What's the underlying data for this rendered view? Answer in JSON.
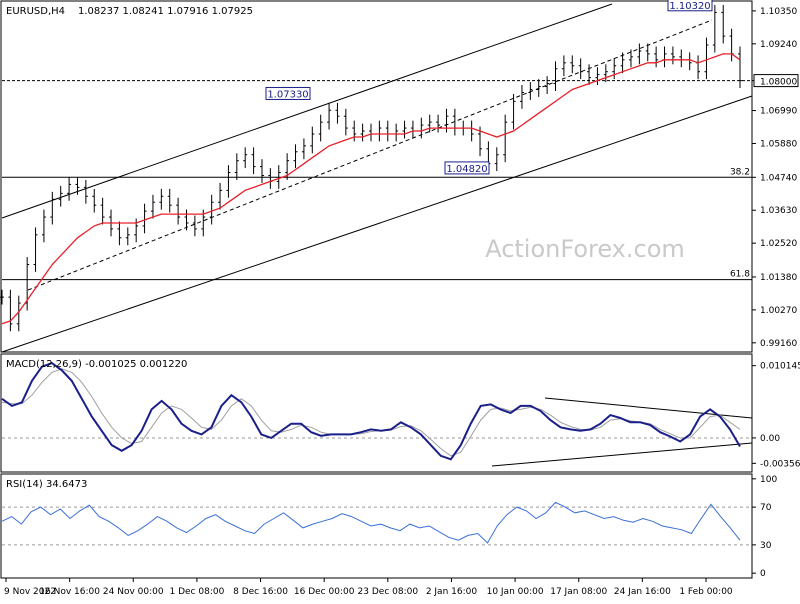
{
  "chart_data": [
    {
      "type": "line",
      "subtype": "ohlc",
      "symbol": "EURUSD,H4",
      "ohlc_header": "1.08237 1.08241 1.07916 1.07925",
      "watermark": "ActionForex.com",
      "x_ticks": [
        "9 Nov 2022",
        "16 Nov 16:00",
        "24 Nov 00:00",
        "1 Dec 08:00",
        "8 Dec 16:00",
        "16 Dec 00:00",
        "23 Dec 08:00",
        "2 Jan 16:00",
        "10 Jan 00:00",
        "17 Jan 08:00",
        "24 Jan 16:00",
        "1 Feb 00:00"
      ],
      "y_ticks": [
        "1.10350",
        "1.09240",
        "1.08000",
        "1.06990",
        "1.05880",
        "1.04740",
        "1.03630",
        "1.02520",
        "1.01380",
        "1.00270",
        "0.99160"
      ],
      "y_tick_values": [
        1.1035,
        1.0924,
        1.08,
        1.0699,
        1.0588,
        1.0474,
        1.0363,
        1.0252,
        1.0138,
        1.0027,
        0.9916
      ],
      "ylim": [
        0.9885,
        1.1065
      ],
      "price_label": "1.08000",
      "level_labels": [
        {
          "text": "1.07330",
          "value": 1.0733
        },
        {
          "text": "1.04820",
          "value": 1.0482
        },
        {
          "text": "1.10320",
          "value": 1.1032
        }
      ],
      "fib_levels": [
        {
          "label": "38.2",
          "value": 1.0474
        },
        {
          "label": "61.8",
          "value": 1.0129
        }
      ],
      "series": [
        {
          "color": "#000000",
          "values": [
            1.007,
            0.998,
            1.005,
            1.018,
            1.028,
            1.034,
            1.04,
            1.042,
            1.045,
            1.044,
            1.041,
            1.038,
            1.034,
            1.03,
            1.027,
            1.028,
            1.031,
            1.036,
            1.039,
            1.041,
            1.038,
            1.034,
            1.032,
            1.03,
            1.034,
            1.039,
            1.043,
            1.049,
            1.053,
            1.055,
            1.051,
            1.048,
            1.046,
            1.049,
            1.053,
            1.056,
            1.058,
            1.062,
            1.066,
            1.07,
            1.068,
            1.064,
            1.062,
            1.063,
            1.062,
            1.064,
            1.062,
            1.063,
            1.064,
            1.063,
            1.065,
            1.066,
            1.065,
            1.068,
            1.064,
            1.064,
            1.062,
            1.057,
            1.052,
            1.055,
            1.066,
            1.073,
            1.076,
            1.077,
            1.078,
            1.079,
            1.084,
            1.086,
            1.085,
            1.083,
            1.081,
            1.082,
            1.083,
            1.085,
            1.087,
            1.088,
            1.09,
            1.089,
            1.087,
            1.089,
            1.088,
            1.087,
            1.086,
            1.083,
            1.092,
            1.103,
            1.095,
            1.089,
            1.08
          ]
        },
        {
          "color": "#e8202a",
          "values": [
            0.998,
            0.999,
            1.002,
            1.006,
            1.01,
            1.014,
            1.018,
            1.021,
            1.024,
            1.027,
            1.029,
            1.031,
            1.032,
            1.032,
            1.032,
            1.032,
            1.032,
            1.033,
            1.034,
            1.035,
            1.035,
            1.035,
            1.035,
            1.035,
            1.035,
            1.036,
            1.037,
            1.039,
            1.041,
            1.043,
            1.044,
            1.045,
            1.046,
            1.047,
            1.048,
            1.05,
            1.052,
            1.054,
            1.056,
            1.058,
            1.059,
            1.06,
            1.061,
            1.061,
            1.062,
            1.062,
            1.062,
            1.062,
            1.062,
            1.063,
            1.063,
            1.064,
            1.064,
            1.064,
            1.064,
            1.064,
            1.064,
            1.063,
            1.062,
            1.061,
            1.062,
            1.063,
            1.065,
            1.067,
            1.069,
            1.071,
            1.073,
            1.075,
            1.077,
            1.078,
            1.079,
            1.08,
            1.081,
            1.082,
            1.083,
            1.084,
            1.085,
            1.086,
            1.086,
            1.087,
            1.087,
            1.087,
            1.087,
            1.086,
            1.087,
            1.088,
            1.089,
            1.089,
            1.087
          ]
        }
      ]
    },
    {
      "type": "line",
      "title": "MACD(12,26,9) -0.001025 0.001220",
      "y_ticks": [
        "0.010145",
        "0.00",
        "-0.003563"
      ],
      "y_tick_values": [
        0.010145,
        0.0,
        -0.003563
      ],
      "ylim": [
        -0.0045,
        0.0115
      ],
      "series": [
        {
          "color": "#1b1f8a",
          "values": [
            0.0055,
            0.0045,
            0.005,
            0.008,
            0.01,
            0.0105,
            0.0095,
            0.008,
            0.0055,
            0.003,
            0.001,
            -0.001,
            -0.0018,
            -0.001,
            0.001,
            0.004,
            0.0052,
            0.004,
            0.002,
            0.001,
            0.0005,
            0.0015,
            0.0045,
            0.006,
            0.005,
            0.003,
            0.0005,
            0.0,
            0.001,
            0.002,
            0.002,
            0.0008,
            0.0003,
            0.0005,
            0.0005,
            0.0005,
            0.0008,
            0.0012,
            0.001,
            0.0012,
            0.0022,
            0.0015,
            0.0005,
            -0.001,
            -0.0025,
            -0.003,
            -0.001,
            0.002,
            0.0045,
            0.0047,
            0.004,
            0.0035,
            0.0045,
            0.0045,
            0.0038,
            0.0025,
            0.0015,
            0.0012,
            0.001,
            0.0012,
            0.002,
            0.0032,
            0.0028,
            0.0022,
            0.0022,
            0.0018,
            0.0008,
            0.0002,
            -0.0005,
            0.0005,
            0.003,
            0.004,
            0.003,
            0.0012,
            -0.0012
          ]
        },
        {
          "color": "#a0a0a0",
          "values": [
            0.005,
            0.0048,
            0.0048,
            0.006,
            0.0078,
            0.0092,
            0.0097,
            0.0092,
            0.0078,
            0.0058,
            0.0035,
            0.0015,
            0.0,
            -0.0008,
            -0.0005,
            0.0015,
            0.0035,
            0.0045,
            0.004,
            0.0028,
            0.0015,
            0.0012,
            0.0025,
            0.0045,
            0.0055,
            0.0045,
            0.0025,
            0.001,
            0.0008,
            0.0012,
            0.0018,
            0.0015,
            0.0008,
            0.0005,
            0.0005,
            0.0005,
            0.0006,
            0.0009,
            0.001,
            0.0011,
            0.0016,
            0.0017,
            0.001,
            -0.0002,
            -0.0015,
            -0.0025,
            -0.002,
            0.0002,
            0.0025,
            0.004,
            0.0042,
            0.0038,
            0.004,
            0.0043,
            0.004,
            0.0032,
            0.0022,
            0.0016,
            0.0012,
            0.0011,
            0.0015,
            0.0025,
            0.0027,
            0.0024,
            0.0022,
            0.002,
            0.0012,
            0.0006,
            0.0,
            0.0,
            0.0015,
            0.003,
            0.0032,
            0.0022,
            0.0012
          ]
        }
      ]
    },
    {
      "type": "line",
      "title": "RSI(14) 34.6473",
      "y_ticks": [
        "100",
        "70",
        "30",
        "0"
      ],
      "y_tick_values": [
        100,
        70,
        30,
        0
      ],
      "ylim": [
        -3,
        103
      ],
      "series": [
        {
          "color": "#3a6fd8",
          "values": [
            55,
            60,
            52,
            65,
            70,
            62,
            68,
            58,
            66,
            72,
            60,
            55,
            48,
            40,
            45,
            52,
            60,
            55,
            48,
            43,
            50,
            58,
            62,
            55,
            50,
            45,
            42,
            52,
            58,
            64,
            56,
            48,
            52,
            55,
            58,
            63,
            60,
            55,
            50,
            52,
            48,
            45,
            52,
            48,
            50,
            44,
            38,
            35,
            40,
            42,
            32,
            50,
            62,
            70,
            66,
            58,
            64,
            75,
            70,
            64,
            66,
            62,
            58,
            60,
            56,
            54,
            58,
            55,
            50,
            48,
            46,
            42,
            58,
            73,
            60,
            48,
            35
          ]
        }
      ]
    }
  ]
}
